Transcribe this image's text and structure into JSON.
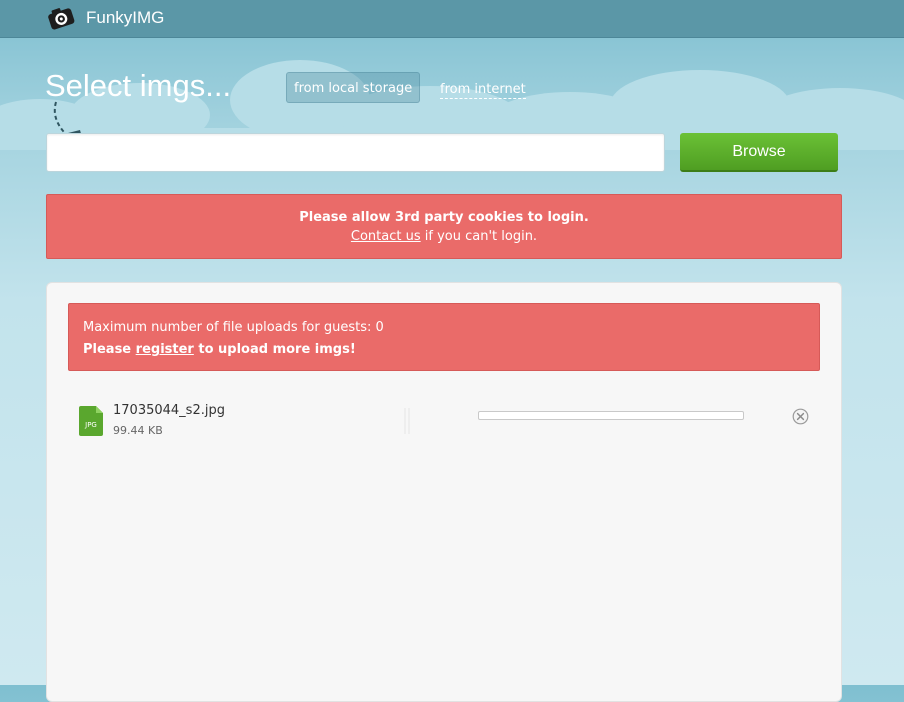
{
  "header": {
    "brand": "FunkyIMG"
  },
  "upload": {
    "title": "Select imgs...",
    "sources": [
      {
        "label": "from local storage",
        "active": true
      },
      {
        "label": "from internet",
        "active": false
      }
    ],
    "file_input_value": "",
    "browse_label": "Browse"
  },
  "cookie_alert": {
    "line1": "Please allow 3rd party cookies to login.",
    "link": "Contact us",
    "line2_rest": " if you can't login."
  },
  "guest_alert": {
    "line1": "Maximum number of file uploads for guests: 0",
    "prefix": "Please ",
    "link": "register",
    "suffix": " to upload more imgs!"
  },
  "files": [
    {
      "icon_label": "JPG",
      "name": "17035044_s2.jpg",
      "size": "99.44 KB",
      "progress": 0
    }
  ],
  "icons": {
    "logo": "camera-icon",
    "file": "jpg-file-icon",
    "remove": "close-circle-icon",
    "arrow": "curved-arrow-icon"
  },
  "colors": {
    "topbar": "#5b97a7",
    "alert": "#ea6b69",
    "browse": "#5aaf2a"
  }
}
